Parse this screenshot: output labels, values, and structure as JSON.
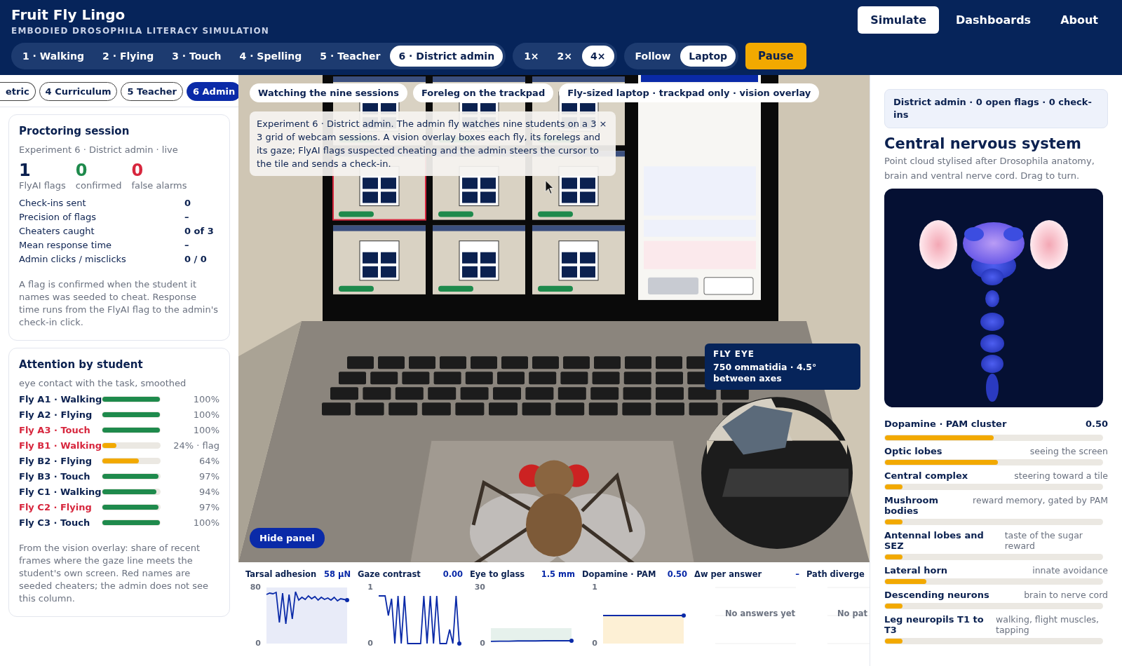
{
  "header": {
    "title": "Fruit Fly Lingo",
    "subtitle": "EMBODIED DROSOPHILA LITERACY SIMULATION",
    "nav": [
      {
        "label": "Simulate",
        "selected": true
      },
      {
        "label": "Dashboards",
        "selected": false
      },
      {
        "label": "About",
        "selected": false
      }
    ]
  },
  "toolbar": {
    "experiments": [
      {
        "label": "1 · Walking",
        "selected": false
      },
      {
        "label": "2 · Flying",
        "selected": false
      },
      {
        "label": "3 · Touch",
        "selected": false
      },
      {
        "label": "4 · Spelling",
        "selected": false
      },
      {
        "label": "5 · Teacher",
        "selected": false
      },
      {
        "label": "6 · District admin",
        "selected": true
      }
    ],
    "speeds": [
      {
        "label": "1×",
        "selected": false
      },
      {
        "label": "2×",
        "selected": false
      },
      {
        "label": "4×",
        "selected": true
      }
    ],
    "camera": [
      {
        "label": "Follow",
        "selected": false
      },
      {
        "label": "Laptop",
        "selected": true
      }
    ],
    "pause": "Pause"
  },
  "left_panel": {
    "tabs": [
      {
        "label": "etric",
        "selected": false
      },
      {
        "label": "4 Curriculum",
        "selected": false
      },
      {
        "label": "5 Teacher",
        "selected": false
      },
      {
        "label": "6 Admin",
        "selected": true
      }
    ],
    "session": {
      "title": "Proctoring session",
      "subtitle": "Experiment 6 · District admin · live",
      "stats": [
        {
          "value": "1",
          "label": "FlyAI flags",
          "color": "#0b2150"
        },
        {
          "value": "0",
          "label": "confirmed",
          "color": "#1e8a4c"
        },
        {
          "value": "0",
          "label": "false alarms",
          "color": "#d7263d"
        }
      ],
      "rows": [
        {
          "label": "Check-ins sent",
          "value": "0"
        },
        {
          "label": "Precision of flags",
          "value": "–"
        },
        {
          "label": "Cheaters caught",
          "value": "0 of 3"
        },
        {
          "label": "Mean response time",
          "value": "–"
        },
        {
          "label": "Admin clicks / misclicks",
          "value": "0 / 0"
        }
      ],
      "note": "A flag is confirmed when the student it names was seeded to cheat. Response time runs from the FlyAI flag to the admin's check-in click."
    },
    "attention": {
      "title": "Attention by student",
      "subtitle": "eye contact with the task, smoothed",
      "students": [
        {
          "name": "Fly A1 · Walking",
          "cheater": false,
          "level": 1,
          "value": "100%"
        },
        {
          "name": "Fly A2 · Flying",
          "cheater": false,
          "level": 1,
          "value": "100%"
        },
        {
          "name": "Fly A3 · Touch",
          "cheater": true,
          "level": 1,
          "value": "100%"
        },
        {
          "name": "Fly B1 · Walking",
          "cheater": true,
          "level": 0.24,
          "value": "24% · flag"
        },
        {
          "name": "Fly B2 · Flying",
          "cheater": false,
          "level": 0.64,
          "value": "64%"
        },
        {
          "name": "Fly B3 · Touch",
          "cheater": false,
          "level": 0.97,
          "value": "97%"
        },
        {
          "name": "Fly C1 · Walking",
          "cheater": false,
          "level": 0.94,
          "value": "94%"
        },
        {
          "name": "Fly C2 · Flying",
          "cheater": true,
          "level": 0.97,
          "value": "97%"
        },
        {
          "name": "Fly C3 · Touch",
          "cheater": false,
          "level": 1,
          "value": "100%"
        }
      ],
      "note": "From the vision overlay: share of recent frames where the gaze line meets the student's own screen. Red names are seeded cheaters; the admin does not see this column."
    }
  },
  "scene": {
    "chips": [
      "Watching the nine sessions",
      "Foreleg on the trackpad",
      "Fly-sized laptop · trackpad only · vision overlay"
    ],
    "caption": "Experiment 6 · District admin. The admin fly watches nine students on a 3 × 3 grid of webcam sessions. A vision overlay boxes each fly, its forelegs and its gaze; FlyAI flags suspected cheating and the admin steers the cursor to the tile and sends a check-in.",
    "hide_panel": "Hide panel",
    "fly_eye": {
      "title": "FLY EYE",
      "text": "750 ommatidia · 4.5° between axes"
    }
  },
  "charts": [
    {
      "label": "Tarsal adhesion",
      "reading": "58 µN",
      "chart_data": {
        "type": "line",
        "yticks": [
          0,
          80
        ],
        "ylim": [
          0,
          80
        ],
        "series": [
          {
            "color": "#0a2aa8",
            "values": [
              70,
              72,
              71,
              73,
              30,
              72,
              28,
              70,
              35,
              74,
              62,
              66,
              63,
              68,
              64,
              67,
              62,
              66,
              63,
              65,
              62,
              66,
              61,
              64,
              63,
              62
            ]
          }
        ]
      }
    },
    {
      "label": "Gaze contrast",
      "reading": "0.00",
      "chart_data": {
        "type": "line",
        "yticks": [
          0,
          1
        ],
        "ylim": [
          0,
          1
        ],
        "series": [
          {
            "color": "#0a2aa8",
            "values": [
              0.85,
              0.85,
              0.85,
              0.5,
              0.8,
              0,
              0.85,
              0,
              0.85,
              0,
              0,
              0,
              0,
              0,
              0.85,
              0,
              0.85,
              0,
              0.85,
              0,
              0,
              0,
              0.25,
              0,
              0.85,
              0
            ]
          }
        ]
      }
    },
    {
      "label": "Eye to glass",
      "reading": "1.5 mm",
      "chart_data": {
        "type": "line",
        "yticks": [
          0,
          30
        ],
        "ylim": [
          0,
          30
        ],
        "series": [
          {
            "color": "#0a2aa8",
            "values": [
              1.2,
              1.3,
              1.3,
              1.4,
              1.4,
              1.4,
              1.5,
              1.5,
              1.5,
              1.5
            ]
          }
        ]
      }
    },
    {
      "label": "Dopamine · PAM",
      "reading": "0.50",
      "chart_data": {
        "type": "area",
        "yticks": [
          0,
          1
        ],
        "ylim": [
          0,
          1
        ],
        "series": [
          {
            "color": "#0a2aa8",
            "values": [
              0.5,
              0.5,
              0.5,
              0.5,
              0.5,
              0.5,
              0.5,
              0.5,
              0.5,
              0.5
            ]
          }
        ]
      }
    },
    {
      "label": "Δw per answer",
      "reading": "–",
      "empty_text": "No answers yet"
    },
    {
      "label": "Path diverge",
      "empty_text": "No pat"
    }
  ],
  "right_panel": {
    "status": "District admin · 0 open flags · 0 check-ins",
    "title": "Central nervous system",
    "description": "Point cloud stylised after Drosophila anatomy, brain and ventral nerve cord. Drag to turn.",
    "dopamine": {
      "label": "Dopamine · PAM cluster",
      "value": "0.50",
      "level": 0.5
    },
    "regions": [
      {
        "name": "Optic lobes",
        "description": "seeing the screen",
        "level": 0.52
      },
      {
        "name": "Central complex",
        "description": "steering toward a tile",
        "level": 0.08
      },
      {
        "name": "Mushroom bodies",
        "description": "reward memory, gated by PAM",
        "level": 0.08
      },
      {
        "name": "Antennal lobes and SEZ",
        "description": "taste of the sugar reward",
        "level": 0.08
      },
      {
        "name": "Lateral horn",
        "description": "innate avoidance",
        "level": 0.19
      },
      {
        "name": "Descending neurons",
        "description": "brain to nerve cord",
        "level": 0.08
      },
      {
        "name": "Leg neuropils T1 to T3",
        "description": "walking, flight muscles, tapping",
        "level": 0.08
      }
    ]
  }
}
